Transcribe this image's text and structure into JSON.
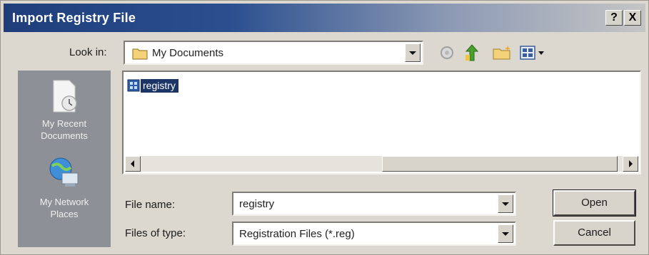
{
  "window": {
    "title": "Import Registry File",
    "help_button": "?",
    "close_button": "X"
  },
  "look_in": {
    "label": "Look in:",
    "value": "My Documents"
  },
  "toolbar": {
    "icons": [
      "back-icon",
      "up-folder-icon",
      "new-folder-icon",
      "views-menu-icon"
    ]
  },
  "places": [
    {
      "label": "My Recent\nDocuments",
      "icon": "recent-documents-icon"
    },
    {
      "label": "My Network\nPlaces",
      "icon": "network-places-icon"
    }
  ],
  "files": [
    {
      "name": "registry",
      "icon": "registry-file-icon",
      "selected": true
    }
  ],
  "file_name": {
    "label": "File name:",
    "value": "registry"
  },
  "file_type": {
    "label": "Files of type:",
    "value": "Registration Files (*.reg)"
  },
  "buttons": {
    "open": "Open",
    "cancel": "Cancel"
  }
}
